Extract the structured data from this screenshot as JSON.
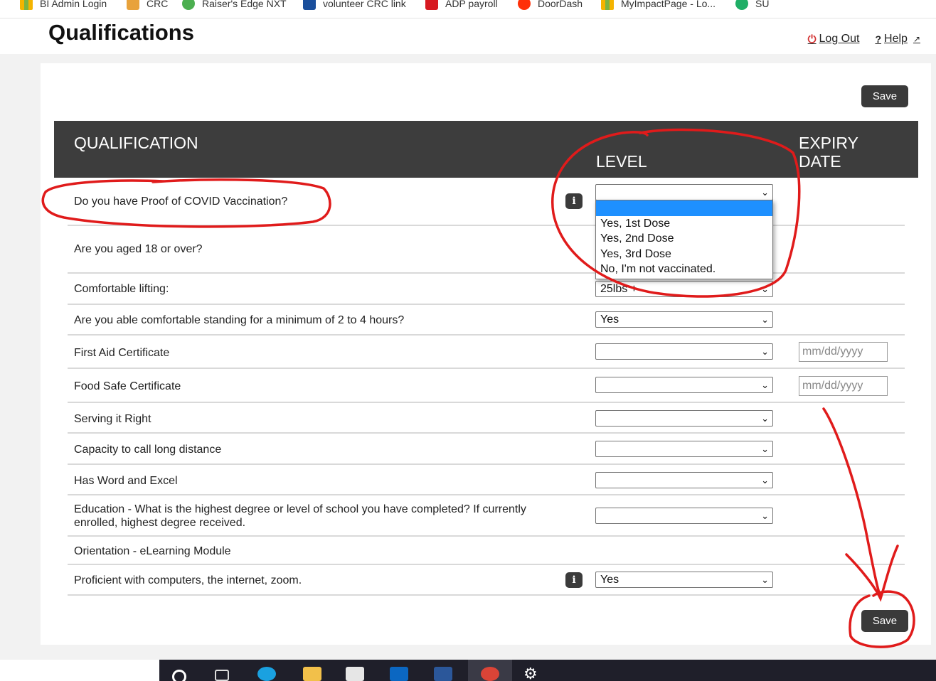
{
  "bookmarks": [
    {
      "label": "BI Admin Login",
      "icon": "grid-icon"
    },
    {
      "label": "CRC",
      "icon": "crc-icon"
    },
    {
      "label": "Raiser's Edge NXT",
      "icon": "raisers-edge-icon"
    },
    {
      "label": "volunteer CRC link",
      "icon": "crc-icon"
    },
    {
      "label": "ADP payroll",
      "icon": "adp-icon"
    },
    {
      "label": "DoorDash",
      "icon": "doordash-icon"
    },
    {
      "label": "MyImpactPage - Lo...",
      "icon": "grid-icon"
    },
    {
      "label": "SU",
      "icon": "owl-icon"
    }
  ],
  "header": {
    "title": "Qualifications",
    "logout_label": "Log Out",
    "help_label": "Help"
  },
  "save_label": "Save",
  "table": {
    "col_qualification": "QUALIFICATION",
    "col_level": "LEVEL",
    "col_expiry": "EXPIRY DATE",
    "rows": [
      {
        "label": "Do you have Proof of COVID Vaccination?",
        "value": "",
        "info": true
      },
      {
        "label": "Are you aged 18 or over?",
        "value": ""
      },
      {
        "label": "Comfortable lifting:",
        "value": "25lbs +"
      },
      {
        "label": "Are you able comfortable standing for a minimum of 2 to 4 hours?",
        "value": "Yes"
      },
      {
        "label": "First Aid Certificate",
        "value": "",
        "date_placeholder": "mm/dd/yyyy"
      },
      {
        "label": "Food Safe Certificate",
        "value": "",
        "date_placeholder": "mm/dd/yyyy"
      },
      {
        "label": "Serving it Right",
        "value": ""
      },
      {
        "label": "Capacity to call long distance",
        "value": ""
      },
      {
        "label": "Has Word and Excel",
        "value": ""
      },
      {
        "label": "Education - What is the highest degree or level of school you have completed? If currently enrolled, highest degree received.",
        "value": ""
      },
      {
        "label": "Orientation - eLearning Module"
      },
      {
        "label": "Proficient with computers, the internet, zoom.",
        "value": "Yes",
        "info": true
      }
    ]
  },
  "dropdown": {
    "options": [
      "",
      "Yes, 1st Dose",
      "Yes, 2nd Dose",
      "Yes, 3rd Dose",
      "No, I'm not vaccinated."
    ]
  },
  "colors": {
    "header_bg": "#3d3d3d",
    "save_bg": "#3a3a3a",
    "highlight": "#1e90ff",
    "annotation": "#e01b1b"
  }
}
